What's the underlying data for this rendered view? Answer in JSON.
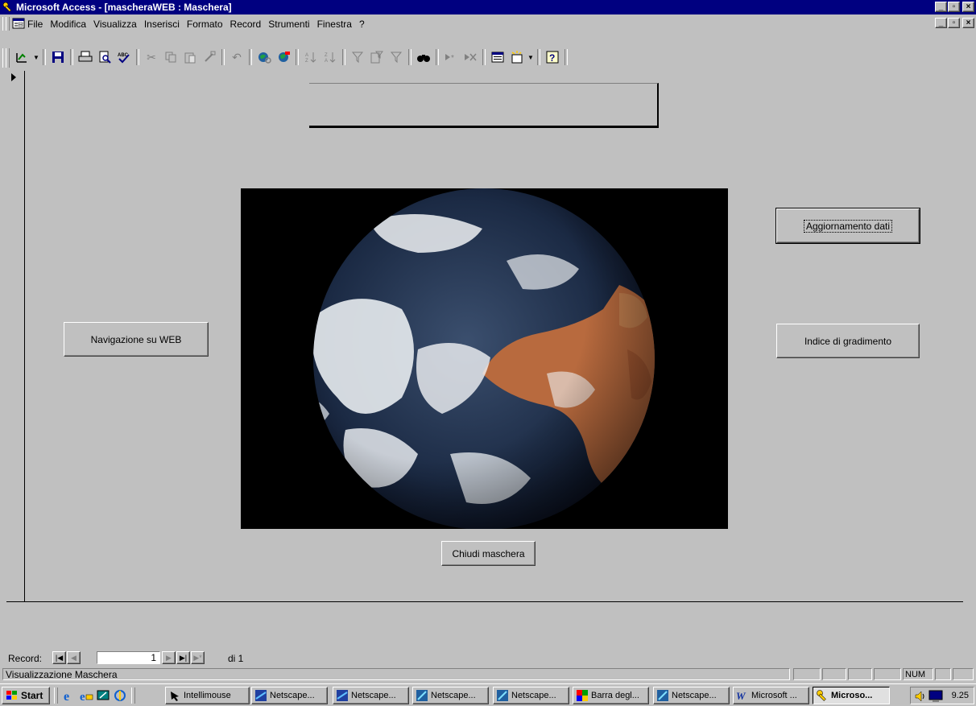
{
  "window": {
    "title": "Microsoft Access - [mascheraWEB : Maschera]",
    "title_bg": "#000080",
    "minimize": "_",
    "restore": "▫",
    "close": "×"
  },
  "menu": {
    "items": [
      "File",
      "Modifica",
      "Visualizza",
      "Inserisci",
      "Formato",
      "Record",
      "Strumenti",
      "Finestra",
      "?"
    ]
  },
  "toolbar": {
    "icons": [
      "view-design-icon",
      "save-icon",
      "print-icon",
      "print-preview-icon",
      "spelling-icon",
      "cut-icon",
      "copy-icon",
      "paste-icon",
      "format-painter-icon",
      "undo-icon",
      "insert-hyperlink-icon",
      "web-toolbar-icon",
      "sort-ascending-icon",
      "sort-descending-icon",
      "filter-by-selection-icon",
      "filter-by-form-icon",
      "apply-filter-icon",
      "find-icon",
      "new-record-icon",
      "delete-record-icon",
      "database-window-icon",
      "new-object-icon",
      "help-icon"
    ]
  },
  "form": {
    "buttons": {
      "navigate_web": "Navigazione su WEB",
      "update_data": "Aggiornamento dati",
      "rating_index": "Indice di gradimento",
      "close_form": "Chiudi maschera"
    },
    "picture": "earth-photo"
  },
  "navigation": {
    "label": "Record:",
    "current": "1",
    "of_total": "di 1"
  },
  "status": {
    "text": "Visualizzazione Maschera",
    "num": "NUM"
  },
  "taskbar": {
    "start": "Start",
    "tasks": [
      "Intellimouse",
      "Netscape...",
      "Netscape...",
      "Netscape...",
      "Netscape...",
      "Barra degl...",
      "Netscape...",
      "Microsoft ...",
      "Microso..."
    ],
    "active_index": 8,
    "clock": "9.25"
  }
}
